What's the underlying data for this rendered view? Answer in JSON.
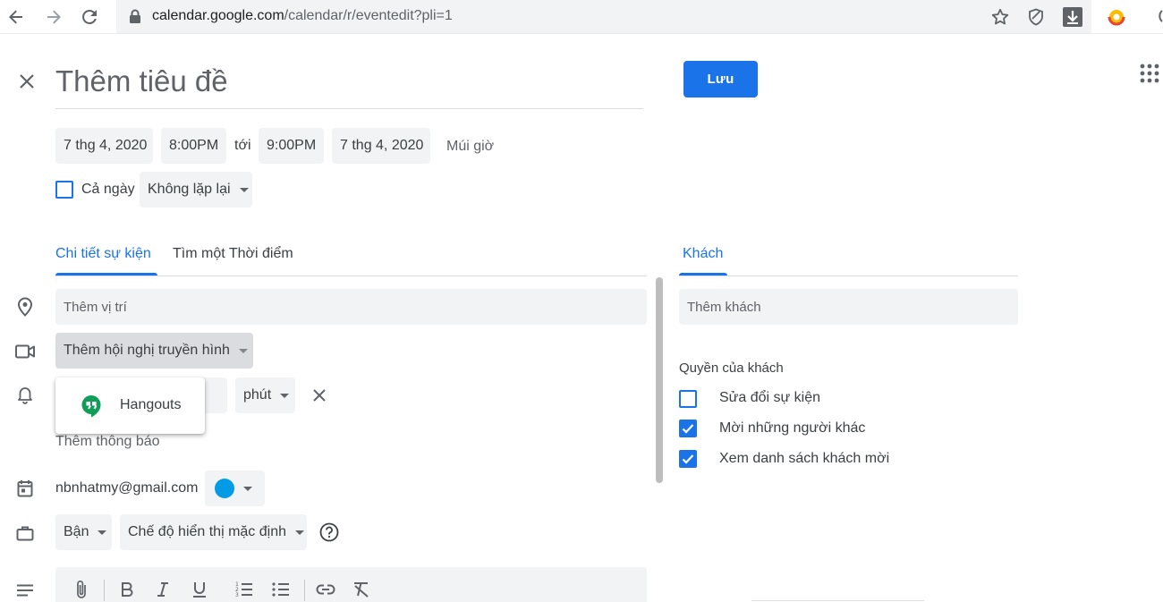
{
  "browser": {
    "url_domain": "calendar.google.com",
    "url_path": "/calendar/r/eventedit?pli=1"
  },
  "event": {
    "title_placeholder": "Thêm tiêu đề",
    "save_label": "Lưu",
    "start_date": "7 thg 4, 2020",
    "start_time": "8:00PM",
    "to_label": "tới",
    "end_time": "9:00PM",
    "end_date": "7 thg 4, 2020",
    "timezone_label": "Múi giờ",
    "all_day_label": "Cả ngày",
    "repeat_value": "Không lặp lại"
  },
  "tabs": {
    "details": "Chi tiết sự kiện",
    "find_time": "Tìm một Thời điểm",
    "guests": "Khách"
  },
  "details": {
    "location_placeholder": "Thêm vị trí",
    "conference_label": "Thêm hội nghị truyền hình",
    "conference_option": "Hangouts",
    "notification_unit": "phút",
    "add_notification": "Thêm thông báo",
    "calendar_owner": "nbnhatmy@gmail.com",
    "calendar_color": "#039be5",
    "busy_value": "Bận",
    "visibility_value": "Chế độ hiển thị mặc định"
  },
  "guests": {
    "add_placeholder": "Thêm khách",
    "permissions_title": "Quyền của khách",
    "permissions": [
      {
        "label": "Sửa đổi sự kiện",
        "checked": false
      },
      {
        "label": "Mời những người khác",
        "checked": true
      },
      {
        "label": "Xem danh sách khách mời",
        "checked": true
      }
    ]
  },
  "colors": {
    "accent": "#1a73e8",
    "chip_bg": "#f1f3f4",
    "hangouts_green": "#0f9d58"
  }
}
